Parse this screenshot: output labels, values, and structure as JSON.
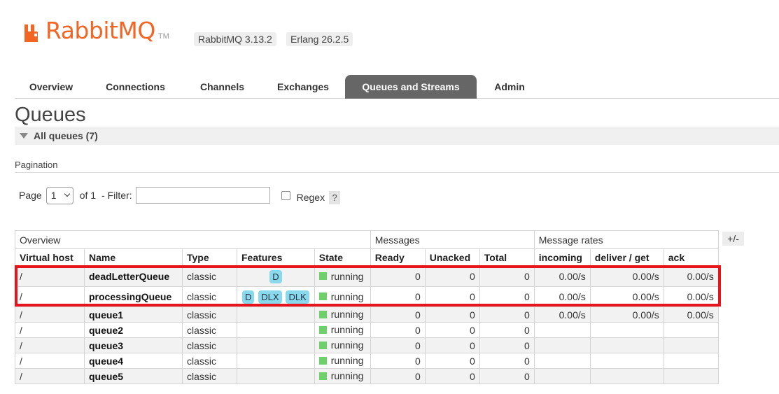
{
  "header": {
    "logo_text": "RabbitMQ",
    "logo_tm": "TM",
    "rabbitmq_version": "RabbitMQ 3.13.2",
    "erlang_version": "Erlang 26.2.5",
    "brand_color": "#f26522"
  },
  "tabs": [
    {
      "label": "Overview",
      "active": false
    },
    {
      "label": "Connections",
      "active": false
    },
    {
      "label": "Channels",
      "active": false
    },
    {
      "label": "Exchanges",
      "active": false
    },
    {
      "label": "Queues and Streams",
      "active": true
    },
    {
      "label": "Admin",
      "active": false
    }
  ],
  "page_title": "Queues",
  "section": {
    "label": "All queues (7)"
  },
  "pagination": {
    "label": "Pagination",
    "page_label": "Page",
    "page_value": "1",
    "of_label": "of 1",
    "filter_label": "- Filter:",
    "filter_value": "",
    "regex_label": "Regex",
    "help_label": "?"
  },
  "table": {
    "group_headers": [
      "Overview",
      "Messages",
      "Message rates"
    ],
    "toggle_label": "+/-",
    "columns": [
      "Virtual host",
      "Name",
      "Type",
      "Features",
      "State",
      "Ready",
      "Unacked",
      "Total",
      "incoming",
      "deliver / get",
      "ack"
    ],
    "rows": [
      {
        "vhost": "/",
        "name": "deadLetterQueue",
        "type": "classic",
        "features": [
          "D"
        ],
        "state": "running",
        "ready": "0",
        "unacked": "0",
        "total": "0",
        "incoming": "0.00/s",
        "deliver_get": "0.00/s",
        "ack": "0.00/s"
      },
      {
        "vhost": "/",
        "name": "processingQueue",
        "type": "classic",
        "features": [
          "D",
          "DLX",
          "DLK"
        ],
        "state": "running",
        "ready": "0",
        "unacked": "0",
        "total": "0",
        "incoming": "0.00/s",
        "deliver_get": "0.00/s",
        "ack": "0.00/s"
      },
      {
        "vhost": "/",
        "name": "queue1",
        "type": "classic",
        "features": [],
        "state": "running",
        "ready": "0",
        "unacked": "0",
        "total": "0",
        "incoming": "0.00/s",
        "deliver_get": "0.00/s",
        "ack": "0.00/s"
      },
      {
        "vhost": "/",
        "name": "queue2",
        "type": "classic",
        "features": [],
        "state": "running",
        "ready": "0",
        "unacked": "0",
        "total": "0",
        "incoming": "",
        "deliver_get": "",
        "ack": ""
      },
      {
        "vhost": "/",
        "name": "queue3",
        "type": "classic",
        "features": [],
        "state": "running",
        "ready": "0",
        "unacked": "0",
        "total": "0",
        "incoming": "",
        "deliver_get": "",
        "ack": ""
      },
      {
        "vhost": "/",
        "name": "queue4",
        "type": "classic",
        "features": [],
        "state": "running",
        "ready": "0",
        "unacked": "0",
        "total": "0",
        "incoming": "",
        "deliver_get": "",
        "ack": ""
      },
      {
        "vhost": "/",
        "name": "queue5",
        "type": "classic",
        "features": [],
        "state": "running",
        "ready": "0",
        "unacked": "0",
        "total": "0",
        "incoming": "",
        "deliver_get": "",
        "ack": ""
      }
    ]
  },
  "colors": {
    "running": "#6ed06a",
    "feature_tag": "#8ad8ec",
    "highlight": "#e8141b",
    "active_tab": "#666666"
  }
}
